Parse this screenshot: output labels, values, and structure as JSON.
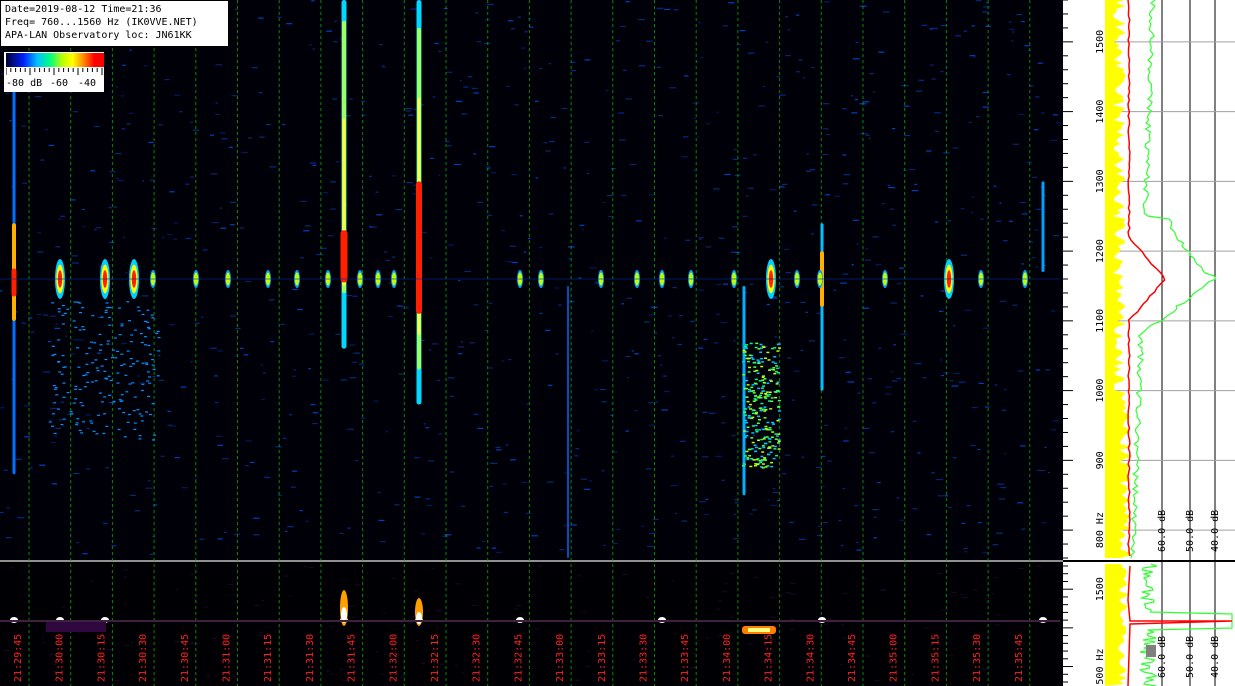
{
  "header": {
    "line1": "Date=2019-08-12 Time=21:36",
    "line2": "Freq= 760...1560 Hz (IK0VVE.NET)",
    "line3": "APA-LAN Observatory loc: JN61KK"
  },
  "color_scale": {
    "labels": [
      "-80 dB",
      "-60",
      "-40"
    ],
    "colors": [
      "#000030",
      "#0020ff",
      "#00c0ff",
      "#00ff80",
      "#c0ff00",
      "#ffff00",
      "#ff8000",
      "#ff0000"
    ]
  },
  "waterfall": {
    "freq_range_hz": [
      760,
      1560
    ],
    "freq_ticks": [
      "800 Hz",
      "900",
      "1000",
      "1100",
      "1200",
      "1300",
      "1400",
      "1500"
    ],
    "freq_tick_values": [
      800,
      900,
      1000,
      1100,
      1200,
      1300,
      1400,
      1500
    ],
    "time_labels": [
      "21:29:45",
      "21:30:00",
      "21:30:15",
      "21:30:30",
      "21:30:45",
      "21:31:00",
      "21:31:15",
      "21:31:30",
      "21:31:45",
      "21:32:00",
      "21:32:15",
      "21:32:30",
      "21:32:45",
      "21:33:00",
      "21:33:15",
      "21:33:30",
      "21:33:45",
      "21:34:00",
      "21:34:15",
      "21:34:30",
      "21:34:45",
      "21:35:00",
      "21:35:15",
      "21:35:30",
      "21:35:45"
    ],
    "grid_color": "#00b000",
    "time_label_color": "#ff2020"
  },
  "lower_panel": {
    "freq_ticks": [
      "500 Hz",
      "1500"
    ],
    "freq_tick_values": [
      500,
      1500
    ]
  },
  "spectrum": {
    "db_labels": [
      "-60.0 dB",
      "-50.0 dB",
      "-40.0 dB"
    ],
    "lower_db_labels": [
      "-60.0 dB",
      "-50.0 dB",
      "-40.0 dB"
    ],
    "yellow": "#ffff00",
    "red": "#ff0000",
    "green": "#30ff30"
  }
}
